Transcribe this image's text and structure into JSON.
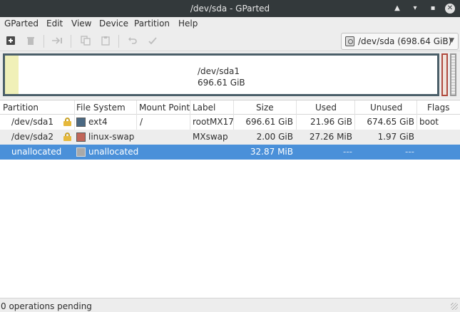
{
  "window": {
    "title": "/dev/sda - GParted",
    "controls": [
      "▲",
      "▾",
      "✕"
    ]
  },
  "menu": [
    "GParted",
    "Edit",
    "View",
    "Device",
    "Partition",
    "Help"
  ],
  "toolbar": {
    "icons": [
      "new-partition-icon",
      "delete-icon",
      "resize-move-icon",
      "copy-icon",
      "paste-icon",
      "undo-icon",
      "apply-icon"
    ]
  },
  "device_selector": {
    "device": "/dev/sda",
    "size": "(698.64 GiB)",
    "display": "/dev/sda   (698.64 GiB)"
  },
  "disk_map": {
    "selected_name": "/dev/sda1",
    "selected_size": "696.61 GiB",
    "used_fraction": 0.031
  },
  "table": {
    "columns": [
      "Partition",
      "File System",
      "Mount Point",
      "Label",
      "Size",
      "Used",
      "Unused",
      "Flags"
    ],
    "rows": [
      {
        "partition": "/dev/sda1",
        "locked": true,
        "fs": "ext4",
        "fs_color": "#4b6983",
        "mount": "/",
        "label": "rootMX17",
        "size": "696.61 GiB",
        "used": "21.96 GiB",
        "unused": "674.65 GiB",
        "flags": "boot"
      },
      {
        "partition": "/dev/sda2",
        "locked": true,
        "fs": "linux-swap",
        "fs_color": "#c1665a",
        "mount": "",
        "label": "MXswap",
        "size": "2.00 GiB",
        "used": "27.26 MiB",
        "unused": "1.97 GiB",
        "flags": ""
      },
      {
        "partition": "unallocated",
        "locked": false,
        "fs": "unallocated",
        "fs_color": "#a9a9a9",
        "mount": "",
        "label": "",
        "size": "32.87 MiB",
        "used": "---",
        "unused": "---",
        "flags": ""
      }
    ]
  },
  "status": {
    "text": "0 operations pending"
  },
  "colors": {
    "titlebar": "#33393b",
    "selection": "#4a90d9",
    "disk_border": "#4b5f69"
  }
}
